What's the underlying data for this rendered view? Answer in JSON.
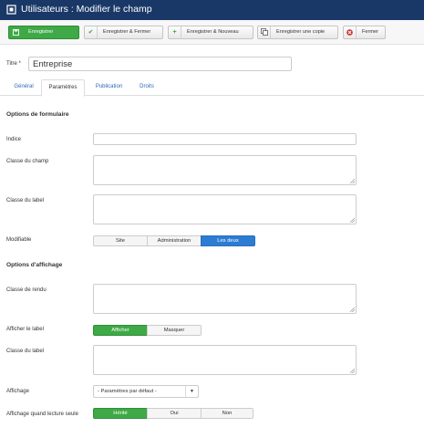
{
  "header": {
    "title": "Utilisateurs : Modifier le champ",
    "icon": "square-icon"
  },
  "toolbar": {
    "save": {
      "label": "Enregistrer",
      "icon": "save-icon"
    },
    "save_close": {
      "label": "Enregistrer & Fermer",
      "icon": "check-icon"
    },
    "save_new": {
      "label": "Enregistrer & Nouveau",
      "icon": "plus-icon"
    },
    "save_copy": {
      "label": "Enregistrer une copie",
      "icon": "copy-icon"
    },
    "close": {
      "label": "Fermer",
      "icon": "cancel-icon"
    }
  },
  "title_field": {
    "label": "Titre *",
    "value": "Entreprise"
  },
  "tabs": [
    {
      "label": "Général",
      "active": false
    },
    {
      "label": "Paramètres",
      "active": true
    },
    {
      "label": "Publication",
      "active": false
    },
    {
      "label": "Droits",
      "active": false
    }
  ],
  "form_options": {
    "heading": "Options de formulaire",
    "hint_label": "Indice",
    "field_class_label": "Classe du champ",
    "label_class_label": "Classe du label",
    "editable_label": "Modifiable",
    "editable_options": [
      "Site",
      "Administration",
      "Les deux"
    ],
    "editable_selected": "Les deux"
  },
  "display_options": {
    "heading": "Options d'affichage",
    "render_class_label": "Classe de rendu",
    "show_label_label": "Afficher le label",
    "show_label_options": [
      "Afficher",
      "Masquer"
    ],
    "show_label_selected": "Afficher",
    "label_class_label": "Classe du label",
    "display_label": "Affichage",
    "display_value": "- Paramètres par défaut -",
    "readonly_label": "Affichage quand lecture seule",
    "readonly_options": [
      "Hérité",
      "Oui",
      "Non"
    ],
    "readonly_selected": "Hérité"
  },
  "colors": {
    "header_bg": "#1a3867",
    "primary_green": "#3ea946",
    "active_blue": "#2c7cd3",
    "link_blue": "#2a69b8",
    "close_red": "#c9302c"
  }
}
